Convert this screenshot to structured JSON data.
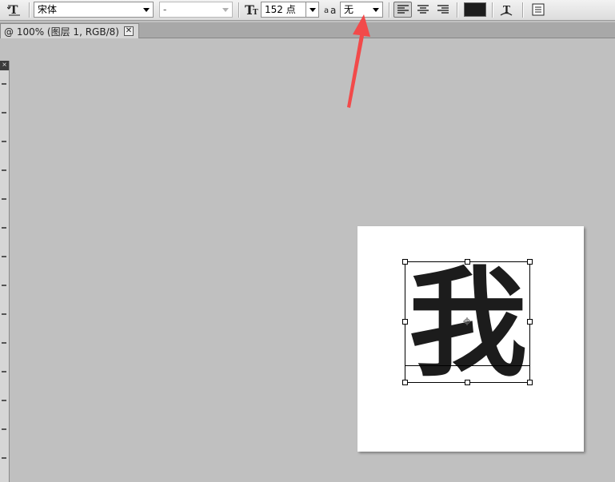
{
  "toolbar": {
    "font_family": "宋体",
    "font_style": "-",
    "font_size": "152 点",
    "antialias": "无"
  },
  "document": {
    "tab_title": "@ 100% (图层 1, RGB/8)",
    "close_glyph": "✕"
  },
  "canvas": {
    "text": "我",
    "text_color": "#1c1c1c"
  },
  "annotation": {
    "arrow_color": "#f24a4a"
  },
  "icons": [
    "text-tool-icon",
    "font-size-icon",
    "antialias-icon",
    "align-left-icon",
    "align-center-icon",
    "align-right-icon",
    "color-swatch",
    "warp-text-icon",
    "character-panel-icon"
  ]
}
